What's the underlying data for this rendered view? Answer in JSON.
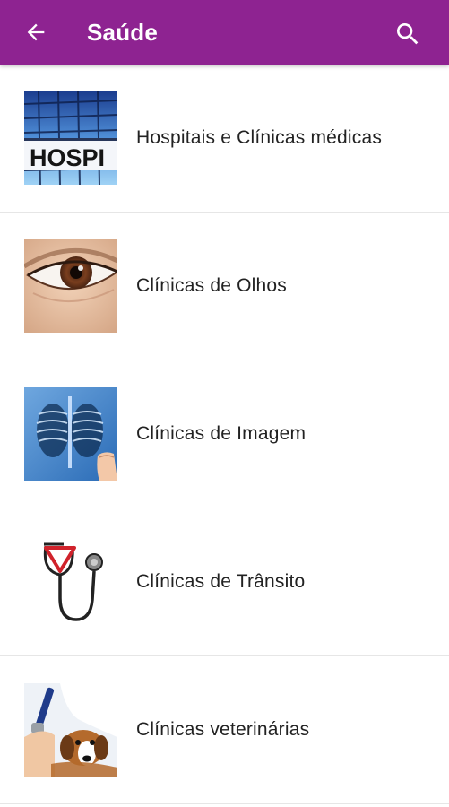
{
  "appbar": {
    "title": "Saúde",
    "back_icon": "arrow-left-icon",
    "search_icon": "search-icon",
    "color": "#8e2391"
  },
  "items": [
    {
      "label": "Hospitais e Clínicas médicas",
      "thumb_text": "HOSPI",
      "icon": "hospital-building-image"
    },
    {
      "label": "Clínicas de Olhos",
      "icon": "eye-image"
    },
    {
      "label": "Clínicas de Imagem",
      "icon": "xray-image"
    },
    {
      "label": "Clínicas de Trânsito",
      "icon": "stethoscope-yield-sign-image"
    },
    {
      "label": "Clínicas veterinárias",
      "icon": "vet-dog-image"
    }
  ]
}
